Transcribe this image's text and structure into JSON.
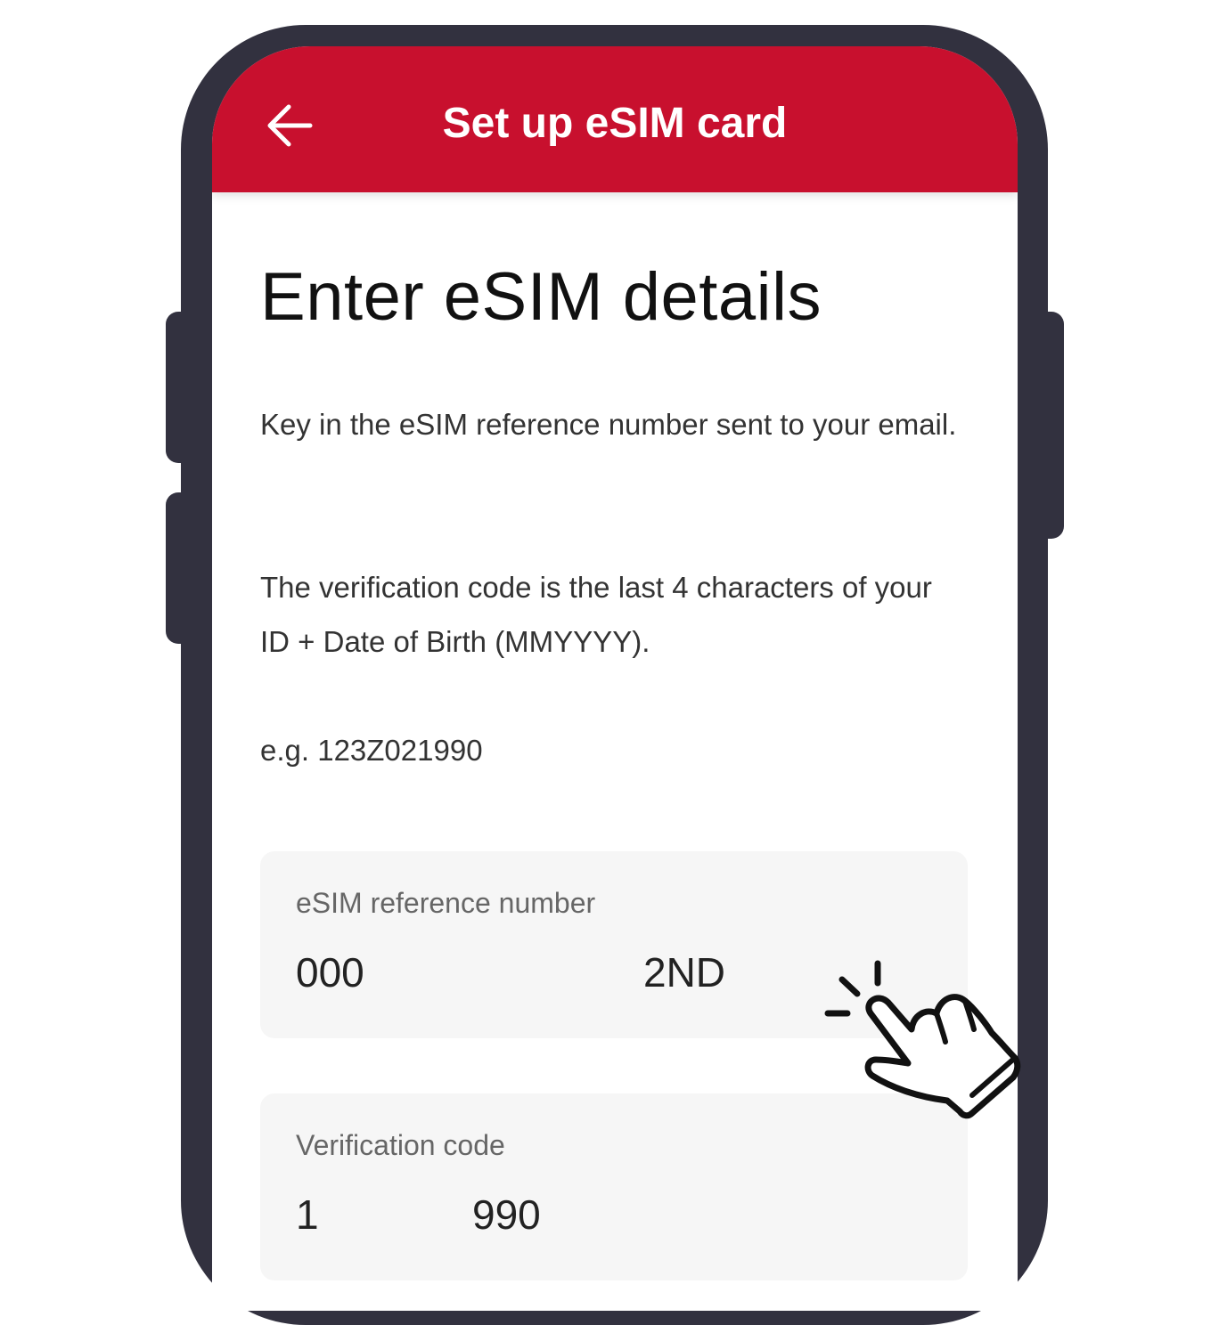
{
  "header": {
    "title": "Set up eSIM card",
    "back_icon": "arrow-left-icon"
  },
  "page": {
    "title": "Enter eSIM details",
    "instruction_1": "Key in the eSIM reference number sent to your email.",
    "instruction_2": "The verification code is the last 4 characters of your ID + Date of Birth (MMYYYY).",
    "example": "e.g. 123Z021990"
  },
  "fields": {
    "reference": {
      "label": "eSIM reference number",
      "value_part1": "000",
      "value_part2": "2ND"
    },
    "verification": {
      "label": "Verification code",
      "value_part1": "1",
      "value_part2": "990"
    }
  },
  "colors": {
    "brand": "#c8102e",
    "phone_frame": "#32313f",
    "field_background": "#f6f6f6"
  },
  "overlay": {
    "icon": "tap-hand-icon"
  }
}
